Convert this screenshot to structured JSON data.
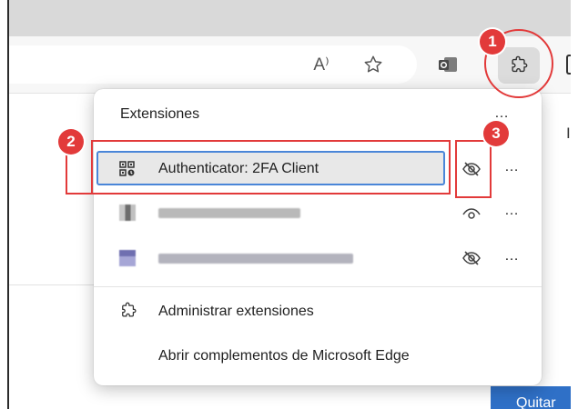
{
  "toolbar": {
    "read_aloud_glyph": "A⁾",
    "icons": [
      "read-aloud-icon",
      "favorite-star-icon",
      "outlook-icon",
      "extensions-puzzle-icon"
    ]
  },
  "page": {
    "side_text": "Ir",
    "quit_button": "Quitar"
  },
  "popup": {
    "title": "Extensiones",
    "more": "…",
    "rows": [
      {
        "label": "Authenticator: 2FA Client",
        "visibility": "hidden",
        "more": "…"
      },
      {
        "label": "",
        "visibility": "visible",
        "more": "…"
      },
      {
        "label": "",
        "visibility": "hidden",
        "more": "…"
      }
    ],
    "manage_label": "Administrar extensiones",
    "addons_label": "Abrir complementos de Microsoft Edge"
  },
  "annotations": {
    "badge_1": "1",
    "badge_2": "2",
    "badge_3": "3",
    "color": "#e23a3a"
  }
}
